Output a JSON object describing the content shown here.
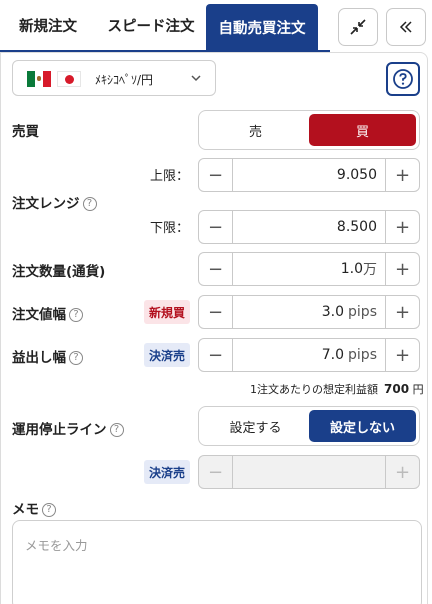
{
  "tabs": [
    {
      "label": "新規注文"
    },
    {
      "label": "スピード注文"
    },
    {
      "label": "自動売買注文"
    }
  ],
  "colors": {
    "accent": "#1a3f8a",
    "sell": "#b3101e"
  },
  "icons": {
    "collapse": "compress-arrows-icon",
    "back": "chevron-double-left-icon",
    "help": "question-circle-icon"
  },
  "pair": {
    "label": "ﾒｷｼｺﾍﾟｿ/円"
  },
  "trade": {
    "label": "売買",
    "options": [
      "売",
      "買"
    ],
    "selected": "買"
  },
  "range": {
    "label": "注文レンジ",
    "upper_label": "上限：",
    "upper_value": "9.050",
    "lower_label": "下限：",
    "lower_value": "8.500"
  },
  "quantity": {
    "label": "注文数量(通貨)",
    "value": "1.0",
    "unit": "万"
  },
  "width": {
    "label": "注文値幅",
    "badge": "新規買",
    "value": "3.0",
    "unit": "pips"
  },
  "profit_width": {
    "label": "益出し幅",
    "badge": "決済売",
    "value": "7.0",
    "unit": "pips"
  },
  "expected_profit": {
    "label": "1注文あたりの想定利益額",
    "value": "700",
    "unit": "円"
  },
  "stop_line": {
    "label": "運用停止ライン",
    "options": [
      "設定する",
      "設定しない"
    ],
    "selected": "設定しない"
  },
  "stop_settle": {
    "badge": "決済売"
  },
  "stepper_minus": "−",
  "stepper_plus": "+",
  "memo": {
    "label": "メモ",
    "placeholder": "メモを入力"
  }
}
